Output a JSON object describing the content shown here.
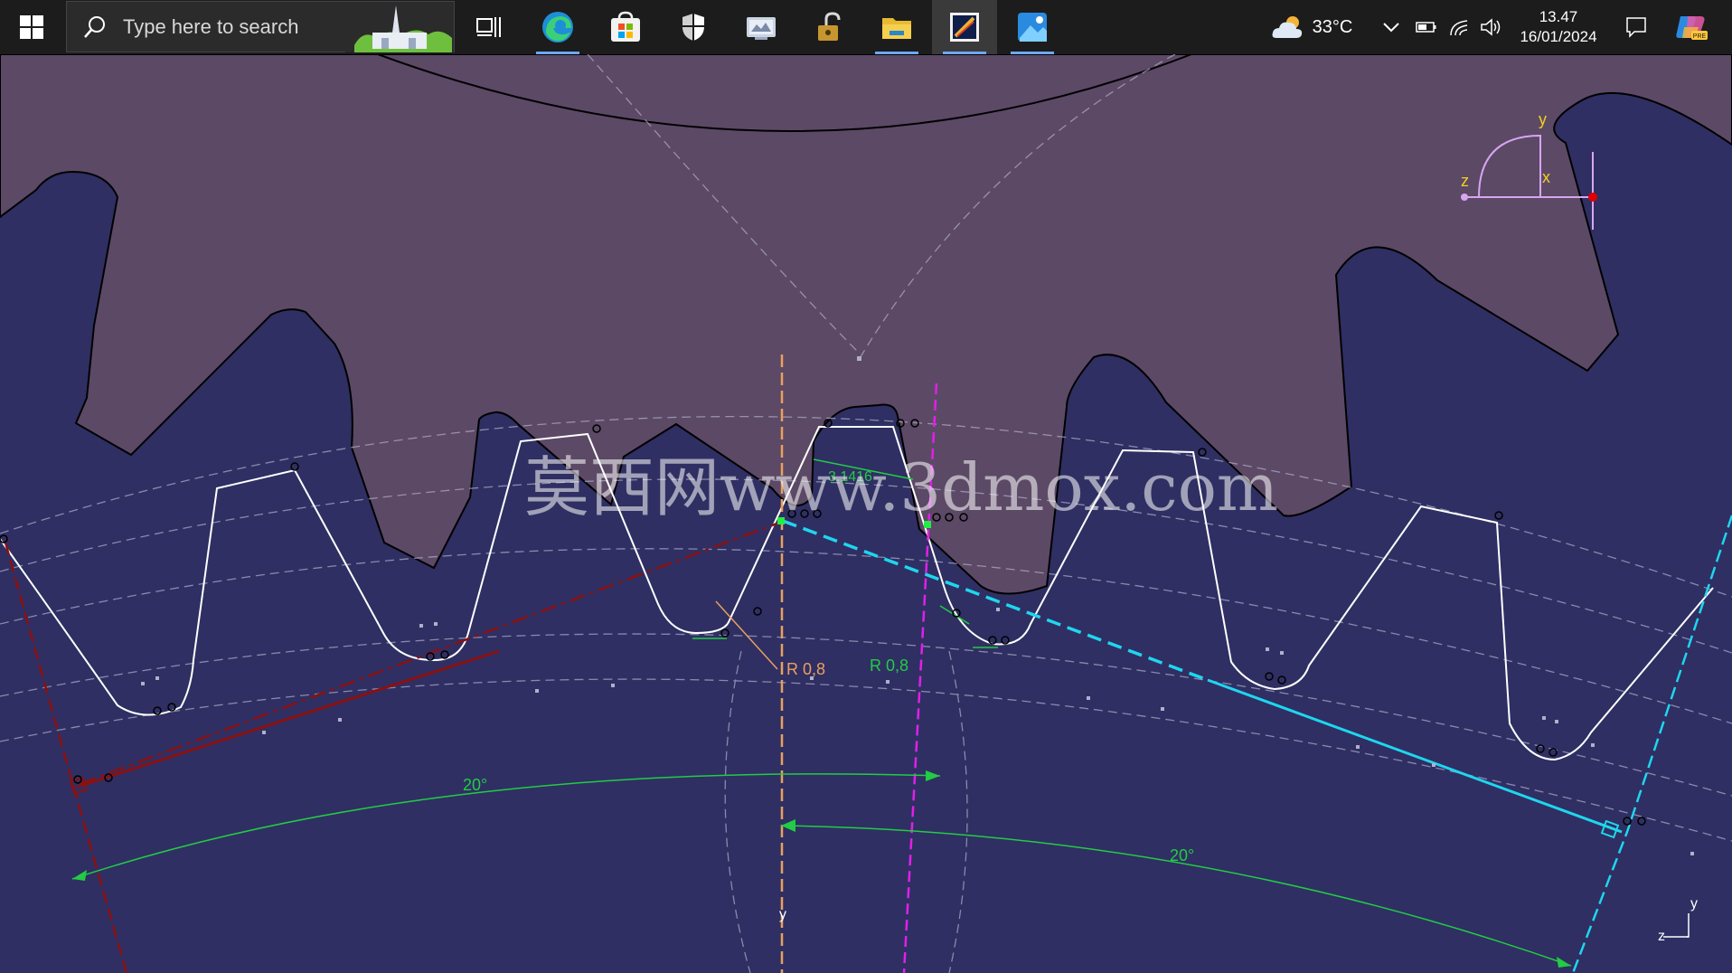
{
  "taskbar": {
    "search_placeholder": "Type here to search",
    "apps": [
      {
        "name": "task-view-icon"
      },
      {
        "name": "edge-icon"
      },
      {
        "name": "store-icon"
      },
      {
        "name": "security-icon"
      },
      {
        "name": "control-panel-icon"
      },
      {
        "name": "lock-app-icon"
      },
      {
        "name": "file-explorer-icon"
      },
      {
        "name": "cad-app-icon"
      },
      {
        "name": "photos-icon"
      }
    ],
    "weather": {
      "temp": "33°C",
      "icon": "cloud-sun-icon"
    },
    "clock": {
      "time": "13.47",
      "date": "16/01/2024"
    }
  },
  "viewport": {
    "watermark": "莫西网www.3dmox.com",
    "dimensions": {
      "tooth_pitch": "3.1416",
      "radius_left": "R 0,8",
      "radius_right": "R 0,8",
      "angle_left": "20°",
      "angle_right": "20°"
    },
    "axes": {
      "y": "y",
      "x": "x",
      "z": "z"
    },
    "colors": {
      "background": "#2f2f63",
      "gear_top": "#5c4966",
      "profile": "#ffffff",
      "dimension": "#22cc44",
      "red_line": "#8b1010",
      "cyan_line": "#1fd6ee",
      "magenta_line": "#e020e8",
      "orange_line": "#e8a060"
    }
  }
}
